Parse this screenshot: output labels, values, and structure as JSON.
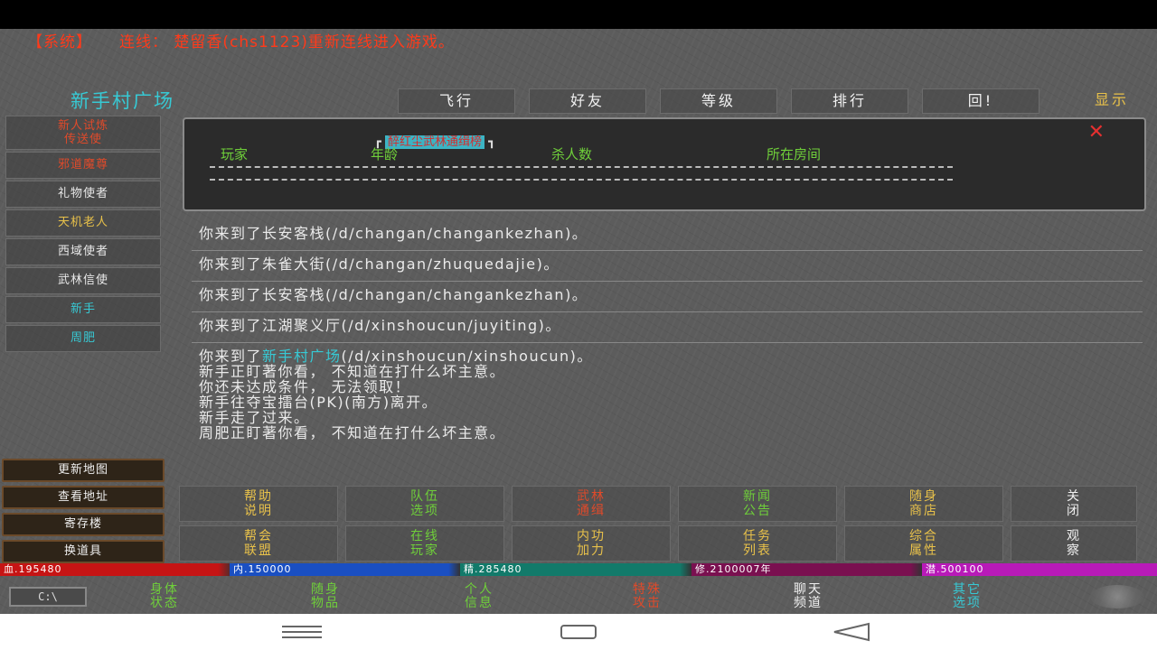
{
  "system": {
    "tag": "【系统】",
    "message": "连线： 楚留香(chs1123)重新连线进入游戏。"
  },
  "location": {
    "title": "新手村广场"
  },
  "topnav": {
    "items": [
      "飞行",
      "好友",
      "等级",
      "排行",
      "回!"
    ],
    "display": "显示"
  },
  "leftmenu": {
    "items": [
      {
        "label": "新人试炼\n传送使",
        "color": "#e04a2a",
        "two": true
      },
      {
        "label": "邪道魔尊",
        "color": "#e04a2a"
      },
      {
        "label": "礼物使者",
        "color": "#e8e8e8"
      },
      {
        "label": "天机老人",
        "color": "#e8c14a"
      },
      {
        "label": "西域使者",
        "color": "#e8e8e8"
      },
      {
        "label": "武林信使",
        "color": "#e8e8e8"
      },
      {
        "label": "新手",
        "color": "#37c9d4"
      },
      {
        "label": "周肥",
        "color": "#37c9d4"
      }
    ]
  },
  "panel": {
    "bracket_left": "┏",
    "bracket_right": "┓",
    "title": "醉红尘武林通缉榜",
    "close": "✕",
    "columns": [
      "玩家",
      "年龄",
      "杀人数",
      "所在房间"
    ]
  },
  "messages": {
    "rows": [
      "你来到了长安客栈(/d/changan/changankezhan)。",
      "你来到了朱雀大街(/d/changan/zhuquedajie)。",
      "你来到了长安客栈(/d/changan/changankezhan)。",
      "你来到了江湖聚义厅(/d/xinshoucun/juyiting)。"
    ],
    "last_prefix": "你来到了",
    "last_room": "新手村广场",
    "last_suffix": "(/d/xinshoucun/xinshoucun)。",
    "lines": [
      "新手正盯著你看， 不知道在打什么坏主意。",
      "你还未达成条件， 无法领取！",
      "新手往夺宝擂台(PK)(南方)离开。",
      "新手走了过来。",
      "周肥正盯著你看， 不知道在打什么坏主意。"
    ]
  },
  "sidebtns": [
    "更新地图",
    "查看地址",
    "寄存楼",
    "换道具"
  ],
  "actions": {
    "row1": [
      {
        "label": "帮助\n说明",
        "color": "yellow"
      },
      {
        "label": "队伍\n选项",
        "color": "green"
      },
      {
        "label": "武林\n通缉",
        "color": "red"
      },
      {
        "label": "新闻\n公告",
        "color": "green"
      },
      {
        "label": "随身\n商店",
        "color": "yellow"
      },
      {
        "label": "关\n闭",
        "color": "white"
      }
    ],
    "row2": [
      {
        "label": "帮会\n联盟",
        "color": "yellow"
      },
      {
        "label": "在线\n玩家",
        "color": "green"
      },
      {
        "label": "内功\n加力",
        "color": "yellow"
      },
      {
        "label": "任务\n列表",
        "color": "yellow"
      },
      {
        "label": "综合\n属性",
        "color": "yellow"
      },
      {
        "label": "观\n察",
        "color": "white"
      }
    ]
  },
  "stats": {
    "hp": "血.195480",
    "mp": "内.150000",
    "jing": "精.285480",
    "xiu": "修.2100007年",
    "qian": "潜.500100"
  },
  "bottomnav": {
    "chat_btn": "C:\\",
    "items": [
      {
        "label": "身体\n状态",
        "color": "green"
      },
      {
        "label": "随身\n物品",
        "color": "green"
      },
      {
        "label": "个人\n信息",
        "color": "green"
      },
      {
        "label": "特殊\n攻击",
        "color": "red"
      },
      {
        "label": "聊天\n频道",
        "color": "white"
      },
      {
        "label": "其它\n选项",
        "color": "cyan"
      }
    ]
  }
}
